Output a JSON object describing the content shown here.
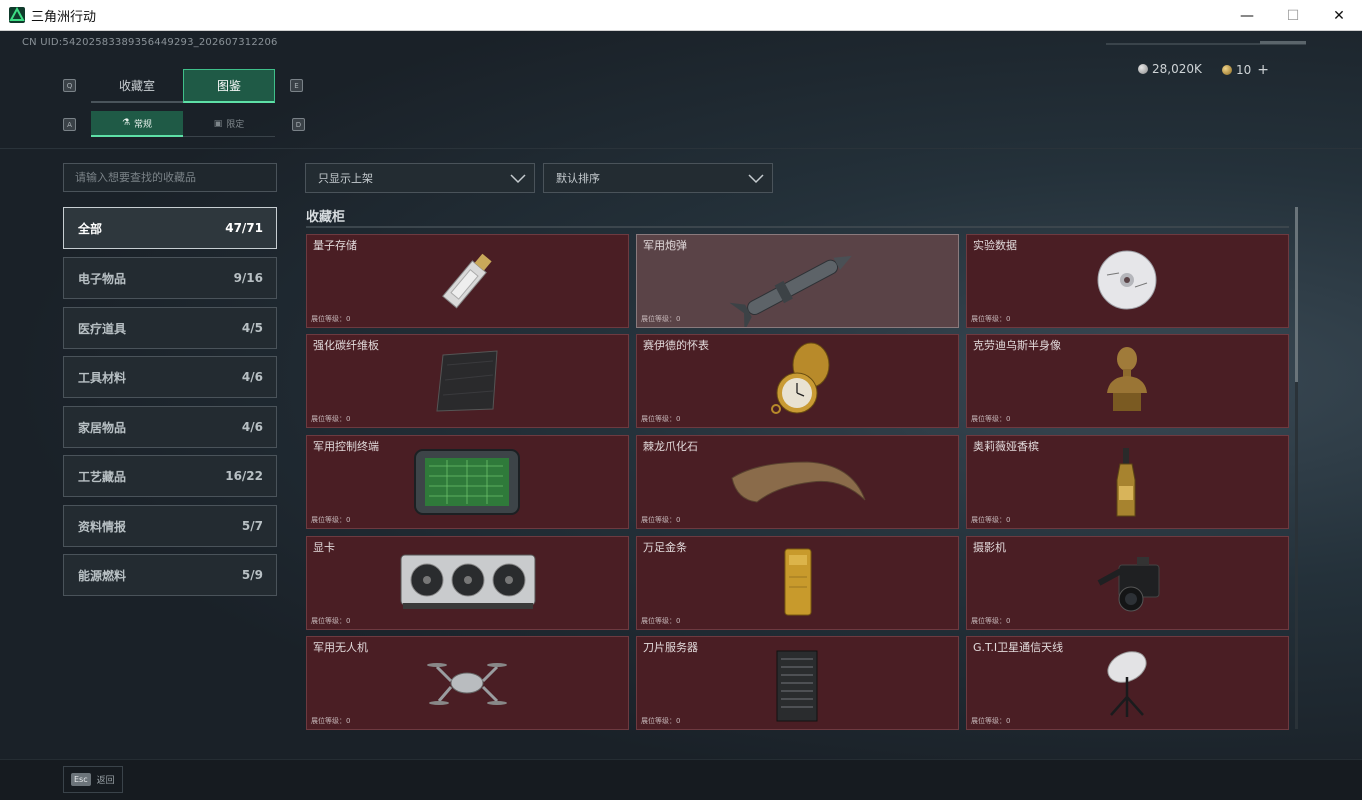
{
  "window": {
    "title": "三角洲行动",
    "min_glyph": "—",
    "max_glyph": "☐",
    "close_glyph": "✕"
  },
  "header": {
    "uid_text": "CN UID:542025833893564492​93_202607312206",
    "currency": {
      "silver_value": "28,020K",
      "gold_value": "10",
      "plus_glyph": "+"
    }
  },
  "tabs": {
    "main": [
      {
        "label": "收藏室",
        "active": false
      },
      {
        "label": "图鉴",
        "active": true
      }
    ],
    "sub": [
      {
        "label": "常规",
        "icon": "flask-icon",
        "active": true
      },
      {
        "label": "限定",
        "icon": "frame-icon",
        "active": false
      }
    ],
    "key_hints": {
      "main_prev": "Q",
      "main_next": "E",
      "sub_prev": "A",
      "sub_next": "D"
    }
  },
  "search": {
    "placeholder": "请输入想要查找的收藏品",
    "value": ""
  },
  "filters": {
    "display_filter": "只显示上架",
    "sort": "默认排序"
  },
  "categories": [
    {
      "label": "全部",
      "count": "47/71",
      "active": true
    },
    {
      "label": "电子物品",
      "count": "9/16",
      "active": false
    },
    {
      "label": "医疗道具",
      "count": "4/5",
      "active": false
    },
    {
      "label": "工具材料",
      "count": "4/6",
      "active": false
    },
    {
      "label": "家居物品",
      "count": "4/6",
      "active": false
    },
    {
      "label": "工艺藏品",
      "count": "16/22",
      "active": false
    },
    {
      "label": "资料情报",
      "count": "5/7",
      "active": false
    },
    {
      "label": "能源燃料",
      "count": "5/9",
      "active": false
    }
  ],
  "cabinet": {
    "title": "收藏柜",
    "level_label": "展位等级：0",
    "items": [
      {
        "name": "量子存储",
        "icon": "usb-drive-icon",
        "highlighted": false
      },
      {
        "name": "军用炮弹",
        "icon": "missile-icon",
        "highlighted": true
      },
      {
        "name": "实验数据",
        "icon": "disc-icon",
        "highlighted": false
      },
      {
        "name": "强化碳纤维板",
        "icon": "carbon-plate-icon",
        "highlighted": false
      },
      {
        "name": "赛伊德的怀表",
        "icon": "pocket-watch-icon",
        "highlighted": false
      },
      {
        "name": "克劳迪乌斯半身像",
        "icon": "bust-icon",
        "highlighted": false
      },
      {
        "name": "军用控制终端",
        "icon": "tablet-terminal-icon",
        "highlighted": false
      },
      {
        "name": "棘龙爪化石",
        "icon": "claw-fossil-icon",
        "highlighted": false
      },
      {
        "name": "奥莉薇娅香槟",
        "icon": "champagne-icon",
        "highlighted": false
      },
      {
        "name": "显卡",
        "icon": "graphics-card-icon",
        "highlighted": false
      },
      {
        "name": "万足金条",
        "icon": "gold-bar-icon",
        "highlighted": false
      },
      {
        "name": "摄影机",
        "icon": "camera-icon",
        "highlighted": false
      },
      {
        "name": "军用无人机",
        "icon": "drone-icon",
        "highlighted": false
      },
      {
        "name": "刀片服务器",
        "icon": "server-icon",
        "highlighted": false
      },
      {
        "name": "G.T.I卫星通信天线",
        "icon": "satellite-dish-icon",
        "highlighted": false
      }
    ]
  },
  "footer": {
    "esc_key": "Esc",
    "back_label": "返回"
  }
}
